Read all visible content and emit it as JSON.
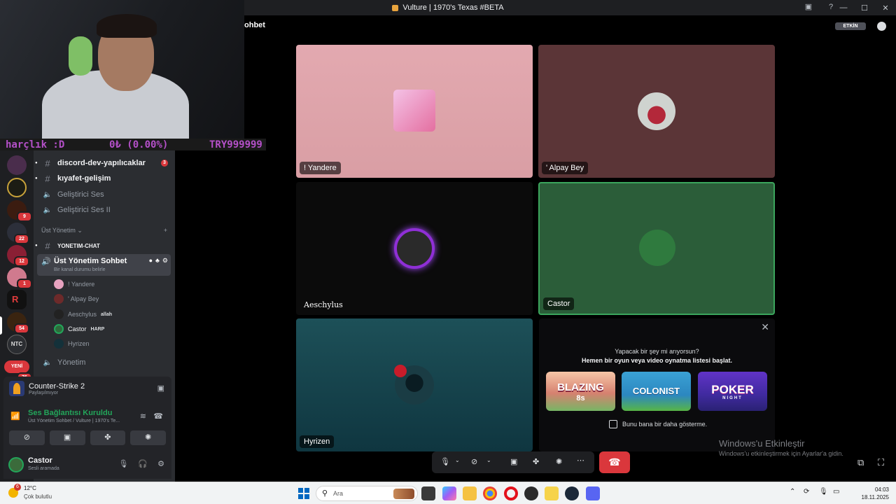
{
  "window": {
    "title": "Vulture | 1970's Texas #BETA",
    "controls": [
      "—",
      "☐",
      "✕"
    ]
  },
  "rail": {
    "badges": [
      "9",
      "22",
      "12",
      "1",
      "54",
      "76"
    ],
    "new_label": "YENİ",
    "ntc_label": "NTC"
  },
  "webcam_ticker": {
    "left": "harçlık :D",
    "mid": "0₺ (0.00%)",
    "right": "TRY999999"
  },
  "header": {
    "partial_title": "ohbet",
    "etkin_label": "ETKİN"
  },
  "channels": [
    {
      "name": "discord-dev-yapılıcaklar",
      "type": "text",
      "unread": true,
      "mentions": "3"
    },
    {
      "name": "kıyafet-gelişim",
      "type": "text",
      "unread": true
    },
    {
      "name": "Geliştirici Ses",
      "type": "voice"
    },
    {
      "name": "Geliştirici Ses II",
      "type": "voice"
    }
  ],
  "category": {
    "name": "Üst Yönetim",
    "add": "+"
  },
  "yonetim_chat": "YONETIM-CHAT",
  "active_voice": {
    "name": "Üst Yönetim Sohbet",
    "status_hint": "Bir kanal durumu belirle"
  },
  "voice_users": [
    {
      "name": "! Yandere",
      "tag": ""
    },
    {
      "name": "' Alpay Bey",
      "tag": ""
    },
    {
      "name": "Aeschylus",
      "tag": "allah"
    },
    {
      "name": "Castor",
      "tag": "HARP"
    },
    {
      "name": "Hyrizen",
      "tag": ""
    }
  ],
  "yonetim_channel": "Yönetim",
  "activity": {
    "game": "Counter-Strike 2",
    "status": "Paylaşılmıyor"
  },
  "voice_status": {
    "title": "Ses Bağlantısı Kuruldu",
    "subtitle": "Üst Yönetim Sohbet / Vulture | 1970's Te..."
  },
  "user_panel": {
    "name": "Castor",
    "status": "Sesli aramada"
  },
  "tiles": [
    {
      "name": "! Yandere",
      "bg": "#d9a0a8"
    },
    {
      "name": "' Alpay Bey",
      "bg": "#5a3436"
    },
    {
      "name": "Aeschylus",
      "bg": "#0b0b0b"
    },
    {
      "name": "Castor",
      "bg": "#2a5a38",
      "speaking": true
    },
    {
      "name": "Hyrizen",
      "bg": "#12414c"
    }
  ],
  "promo": {
    "line1": "Yapacak bir şey mi arıyorsun?",
    "line2": "Hemen bir oyun veya video oynatma listesi başlat.",
    "games": [
      {
        "title": "BLAZING",
        "sub": "8s"
      },
      {
        "title": "COLONIST",
        "sub": ""
      },
      {
        "title": "POKER",
        "sub": "NIGHT"
      }
    ],
    "checkbox": "Bunu bana bir daha gösterme."
  },
  "watermark": {
    "line1": "Windows'u Etkinleştir",
    "line2": "Windows'u etkinleştirmek için Ayarlar'a gidin."
  },
  "taskbar": {
    "weather_badge": "6",
    "temp": "12°C",
    "condition": "Çok bulutlu",
    "search_placeholder": "Ara",
    "time": "04:03",
    "date": "18.11.2025"
  },
  "colors": {
    "discord_red": "#da373c",
    "speaking_green": "#23a55a"
  }
}
